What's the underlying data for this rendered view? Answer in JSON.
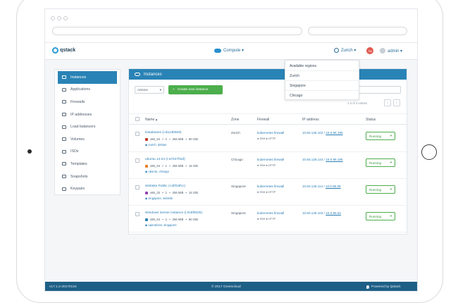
{
  "header": {
    "brand": "qstack",
    "compute_label": "Compute ▾",
    "region_label": "Zurich ▾",
    "avatar_initials": "TM",
    "user_label": "admin ▾"
  },
  "region_dropdown": {
    "title": "Available regions",
    "items": [
      "Zurich",
      "Singapore",
      "Chicago"
    ]
  },
  "sidebar": {
    "items": [
      {
        "label": "Instances",
        "icon": "cloud-icon"
      },
      {
        "label": "Applications",
        "icon": "apps-icon"
      },
      {
        "label": "Firewalls",
        "icon": "firewall-icon"
      },
      {
        "label": "IP addresses",
        "icon": "pin-icon"
      },
      {
        "label": "Load balancers",
        "icon": "balancer-icon"
      },
      {
        "label": "Volumes",
        "icon": "drive-icon"
      },
      {
        "label": "ISOs",
        "icon": "disc-icon"
      },
      {
        "label": "Templates",
        "icon": "template-icon"
      },
      {
        "label": "Snapshots",
        "icon": "camera-icon"
      },
      {
        "label": "Keypairs",
        "icon": "key-icon"
      }
    ]
  },
  "panel": {
    "title": "Instances",
    "actions_label": "Actions",
    "create_label": "Create new instance",
    "pager_text": "1-4 of 4 entries"
  },
  "table": {
    "headers": {
      "name": "Name ▴",
      "zone": "Zone",
      "firewall": "Firewall",
      "ip": "IP address",
      "status": "Status"
    },
    "rows": [
      {
        "name": "Databases (i-da13b9e9)",
        "arch": "x86_64",
        "cpu": "1",
        "ram": "256 MiB",
        "disk": "80 GiB",
        "tags": "zurich, debian",
        "zone": "Zurich",
        "firewall": "kubernetes firewall",
        "rules": "● SSH  ● HTTP",
        "ip1": "10.60.128.102",
        "ip2": "10.0.96.195",
        "status": "Running",
        "os_color": "#c0392b"
      },
      {
        "name": "ubuntu 14.04 (i-a7027f3af)",
        "arch": "x86_64",
        "cpu": "1",
        "ram": "256 MiB",
        "disk": "16 GiB",
        "tags": "ubuntu, chicago",
        "zone": "Chicago",
        "firewall": "kubernetes firewall",
        "rules": "● SSH  ● HTTP",
        "ip1": "10.60.128.144",
        "ip2": "10.0.96.185",
        "status": "Running",
        "os_color": "#e67e22"
      },
      {
        "name": "Website Public (i-d0f19fcc)",
        "arch": "x86_32",
        "cpu": "1",
        "ram": "256 MiB",
        "disk": "16 GiB",
        "tags": "singapore, website",
        "zone": "Singapore",
        "firewall": "kubernetes firewall",
        "rules": "● SSH  ● HTTP",
        "ip1": "10.60.128.114",
        "ip2": "10.0.96.08",
        "status": "Running",
        "os_color": "#8e44ad"
      },
      {
        "name": "Windows Server instance (i-0c8f0025)",
        "arch": "x86_64",
        "cpu": "1",
        "ram": "256 MiB",
        "disk": "80 GiB",
        "tags": "operations, singapore",
        "zone": "Singapore",
        "firewall": "kubernetes firewall",
        "rules": "● SSH  ● HTTP",
        "ip1": "10.60.128.103",
        "ip2": "10.0.96.52",
        "status": "Running",
        "os_color": "#2a83b6"
      }
    ]
  },
  "footer": {
    "version": "v17.1.2-20170124",
    "copyright": "© 2017 Greencloud",
    "powered": "Powered by Qstack"
  }
}
